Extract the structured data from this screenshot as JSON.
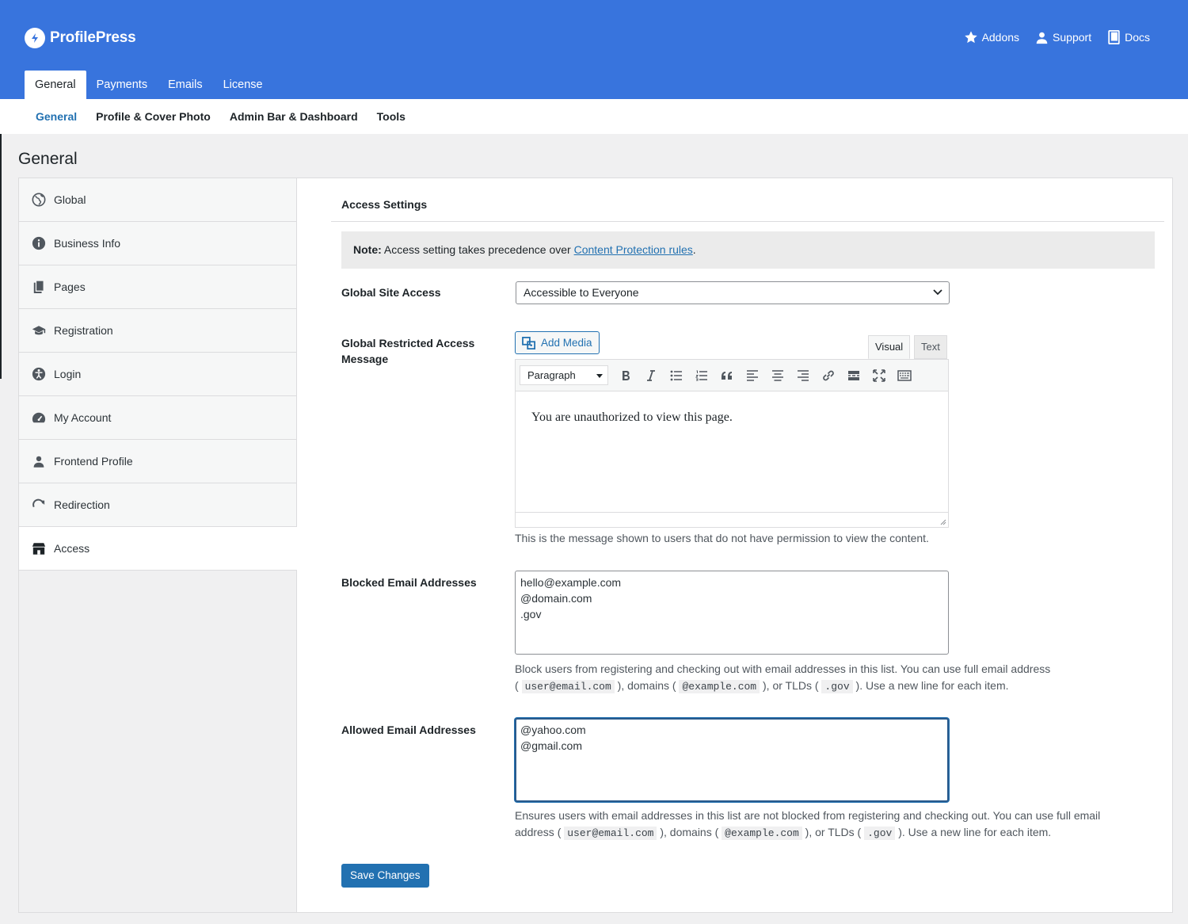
{
  "brand": {
    "name": "ProfilePress"
  },
  "top_links": [
    {
      "label": "Addons",
      "icon": "star-icon"
    },
    {
      "label": "Support",
      "icon": "user-icon"
    },
    {
      "label": "Docs",
      "icon": "book-icon"
    }
  ],
  "main_tabs": [
    {
      "label": "General",
      "active": true
    },
    {
      "label": "Payments"
    },
    {
      "label": "Emails"
    },
    {
      "label": "License"
    }
  ],
  "subnav": [
    {
      "label": "General",
      "active": true
    },
    {
      "label": "Profile & Cover Photo"
    },
    {
      "label": "Admin Bar & Dashboard"
    },
    {
      "label": "Tools"
    }
  ],
  "page_title": "General",
  "sidebar": {
    "items": [
      {
        "label": "Global",
        "icon": "globe-icon"
      },
      {
        "label": "Business Info",
        "icon": "info-icon"
      },
      {
        "label": "Pages",
        "icon": "pages-icon"
      },
      {
        "label": "Registration",
        "icon": "graduation-cap-icon"
      },
      {
        "label": "Login",
        "icon": "accessibility-icon"
      },
      {
        "label": "My Account",
        "icon": "dashboard-icon"
      },
      {
        "label": "Frontend Profile",
        "icon": "user-icon"
      },
      {
        "label": "Redirection",
        "icon": "redo-icon"
      },
      {
        "label": "Access",
        "icon": "store-icon",
        "active": true
      }
    ]
  },
  "access": {
    "section_title": "Access Settings",
    "note_strong": "Note:",
    "note_text": " Access setting takes precedence over ",
    "note_link": "Content Protection rules",
    "note_end": ".",
    "global_site_access_label": "Global Site Access",
    "global_site_access_value": "Accessible to Everyone",
    "restricted_msg_label_line1": "Global Restricted Access",
    "restricted_msg_label_line2": "Message",
    "add_media_label": "Add Media",
    "editor_tab_visual": "Visual",
    "editor_tab_text": "Text",
    "format_select": "Paragraph",
    "editor_content": "You are unauthorized to view this page.",
    "editor_desc": "This is the message shown to users that do not have permission to view the content.",
    "blocked_label": "Blocked Email Addresses",
    "blocked_values": [
      "hello@example.com",
      "@domain.com",
      ".gov"
    ],
    "blocked_desc": {
      "line1": "Block users from registering and checking out with email addresses in this list. You can use full email address",
      "p1": "( ",
      "code1": "user@email.com",
      "p2": " ), domains ( ",
      "code2": "@example.com",
      "p3": " ), or TLDs ( ",
      "code3": ".gov",
      "p4": " ). Use a new line for each item."
    },
    "allowed_label": "Allowed Email Addresses",
    "allowed_values": [
      "@yahoo.com",
      "@gmail.com"
    ],
    "allowed_desc": {
      "line1": "Ensures users with email addresses in this list are not blocked from registering and checking out. You can use full email",
      "p1": "address ( ",
      "code1": "user@email.com",
      "p2": " ), domains ( ",
      "code2": "@example.com",
      "p3": " ), or TLDs ( ",
      "code3": ".gov",
      "p4": " ). Use a new line for each item."
    },
    "save_label": "Save Changes"
  },
  "colors": {
    "header": "#3874dd",
    "accent": "#2271b1"
  }
}
